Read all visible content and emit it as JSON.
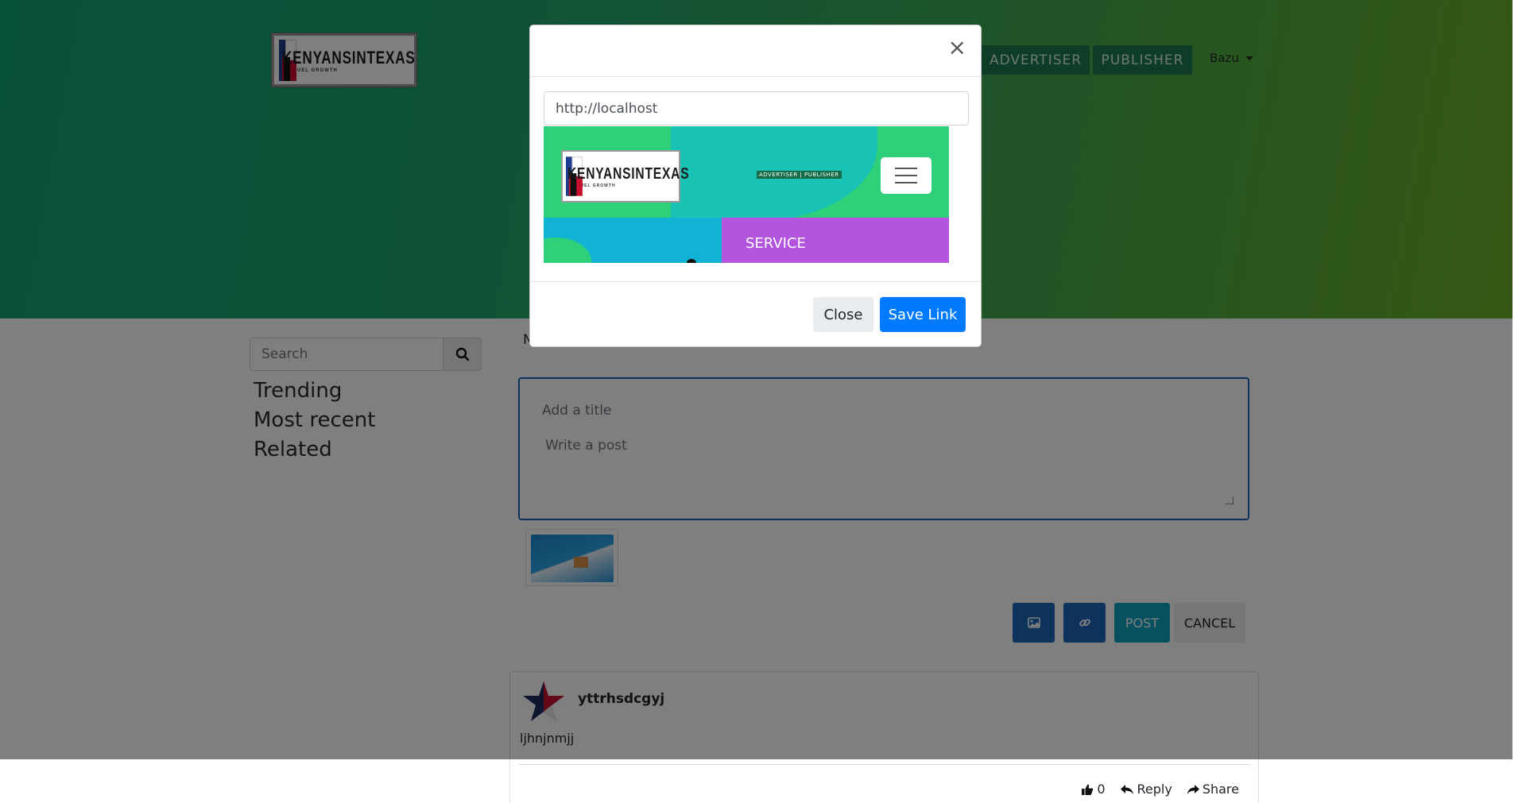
{
  "header": {
    "logo_text": "KENYANSINTEXAS",
    "logo_tagline": "WE FUEL GROWTH",
    "nav": [
      {
        "label": "ADVERTISER"
      },
      {
        "label": "PUBLISHER"
      }
    ],
    "user_menu_label": "Bazu"
  },
  "sidebar": {
    "search_placeholder": "Search",
    "links": [
      {
        "label": "Trending"
      },
      {
        "label": "Most recent"
      },
      {
        "label": "Related"
      }
    ]
  },
  "main": {
    "partial_label": "N",
    "composer": {
      "title_placeholder": "Add a title",
      "body_placeholder": "Write a post"
    },
    "buttons": {
      "post": "POST",
      "cancel": "CANCEL"
    },
    "post": {
      "author": "yttrhsdcgyj",
      "body": "ljhnjnmjj",
      "likes": "0",
      "reply_label": "Reply",
      "share_label": "Share"
    }
  },
  "modal": {
    "url_value": "http://localhost",
    "preview": {
      "logo_text": "KENYANSINTEXAS",
      "logo_tagline": "WE FUEL GROWTH",
      "nav_text": "ADVERTISER | PUBLISHER",
      "service_label": "SERVICE"
    },
    "close_label": "Close",
    "save_label": "Save Link"
  },
  "colors": {
    "primary": "#007bff",
    "action_blue": "#1a66b8",
    "post_cyan": "#0aa2c0",
    "hero_green": "#11a374"
  }
}
